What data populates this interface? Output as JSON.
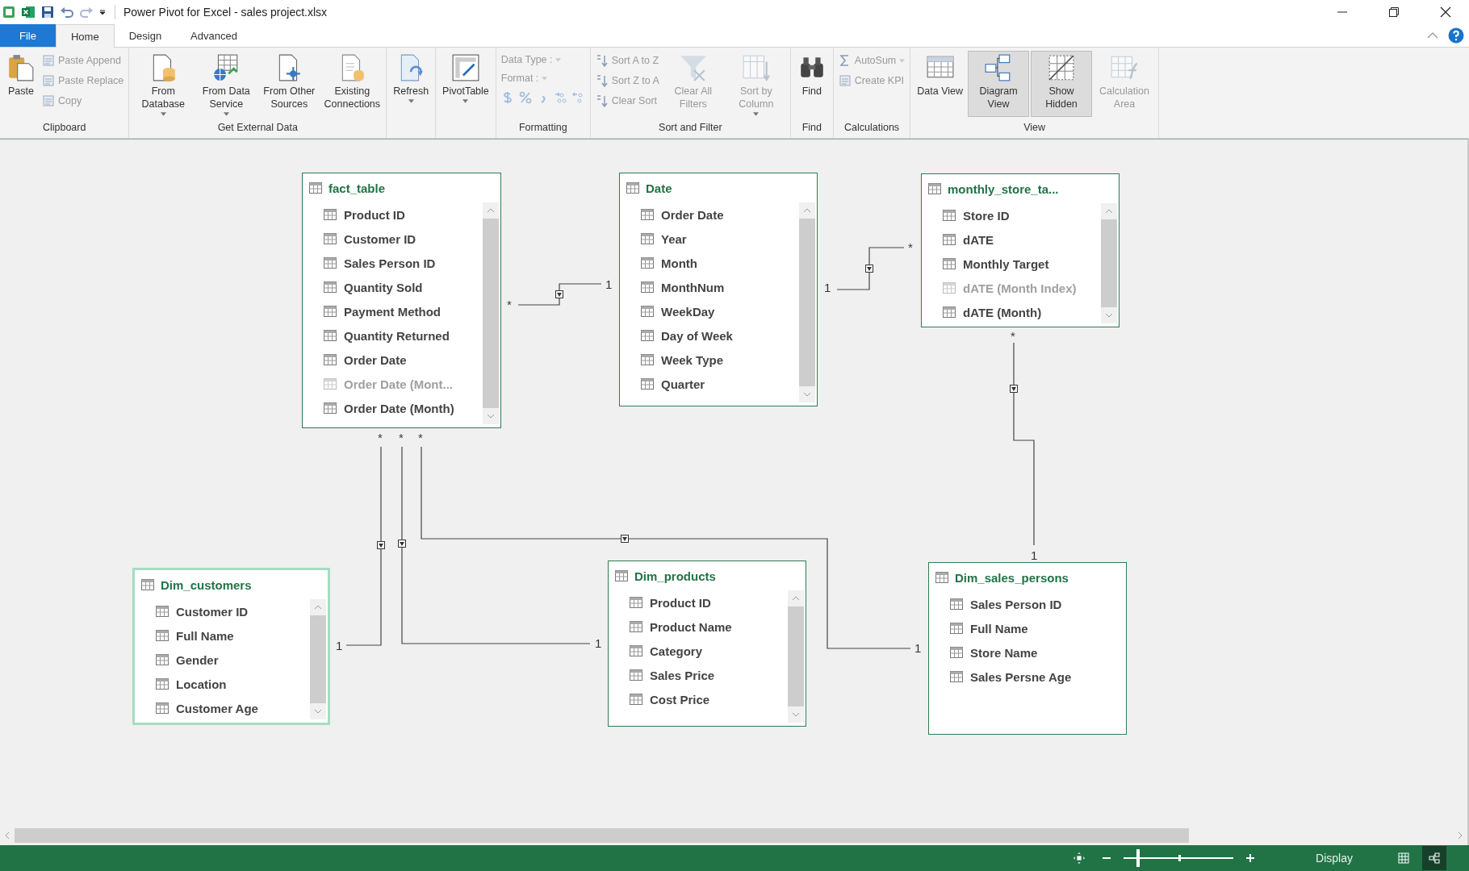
{
  "window": {
    "title": "Power Pivot for Excel - sales project.xlsx"
  },
  "tabs": [
    {
      "label": "File",
      "kind": "file",
      "selected": false
    },
    {
      "label": "Home",
      "kind": "tab",
      "selected": true
    },
    {
      "label": "Design",
      "kind": "tab",
      "selected": false
    },
    {
      "label": "Advanced",
      "kind": "tab",
      "selected": false
    }
  ],
  "ribbon": [
    {
      "label": "Clipboard",
      "buttons": [
        {
          "label": "Paste",
          "kind": "large",
          "disabled": false,
          "dropdown": false
        },
        {
          "label": "Paste Append",
          "kind": "small",
          "disabled": true,
          "dropdown": false
        },
        {
          "label": "Paste Replace",
          "kind": "small",
          "disabled": true,
          "dropdown": false
        },
        {
          "label": "Copy",
          "kind": "small",
          "disabled": true,
          "dropdown": false
        }
      ]
    },
    {
      "label": "Get External Data",
      "buttons": [
        {
          "label": "From Database",
          "kind": "large",
          "disabled": false,
          "dropdown": true
        },
        {
          "label": "From Data Service",
          "kind": "large",
          "disabled": false,
          "dropdown": true
        },
        {
          "label": "From Other Sources",
          "kind": "large",
          "disabled": false,
          "dropdown": false
        },
        {
          "label": "Existing Connections",
          "kind": "large",
          "disabled": false,
          "dropdown": false
        }
      ]
    },
    {
      "buttons": [
        {
          "label": "Refresh",
          "kind": "large",
          "disabled": false,
          "dropdown": true
        }
      ]
    },
    {
      "buttons": [
        {
          "label": "PivotTable",
          "kind": "large",
          "disabled": false,
          "dropdown": true
        }
      ]
    },
    {
      "label": "Formatting",
      "buttons": [
        {
          "label": "Data Type :",
          "kind": "small",
          "disabled": true,
          "dropdown": true
        },
        {
          "label": "Format :",
          "kind": "small",
          "disabled": true,
          "dropdown": true
        },
        {
          "kind": "format-icons",
          "disabled": true
        }
      ]
    },
    {
      "label": "Sort and Filter",
      "buttons": [
        {
          "label": "Sort A to Z",
          "kind": "small",
          "disabled": true,
          "dropdown": false
        },
        {
          "label": "Sort Z to A",
          "kind": "small",
          "disabled": true,
          "dropdown": false
        },
        {
          "label": "Clear Sort",
          "kind": "small",
          "disabled": true,
          "dropdown": false
        },
        {
          "label": "Clear All Filters",
          "kind": "large",
          "disabled": true,
          "dropdown": false
        },
        {
          "label": "Sort by Column",
          "kind": "large",
          "disabled": true,
          "dropdown": true
        }
      ]
    },
    {
      "label": "Find",
      "buttons": [
        {
          "label": "Find",
          "kind": "large",
          "disabled": false,
          "dropdown": false
        }
      ]
    },
    {
      "label": "Calculations",
      "buttons": [
        {
          "label": "AutoSum",
          "kind": "small",
          "disabled": true,
          "dropdown": true
        },
        {
          "label": "Create KPI",
          "kind": "small",
          "disabled": true,
          "dropdown": false
        }
      ]
    },
    {
      "label": "View",
      "buttons": [
        {
          "label": "Data View",
          "kind": "large",
          "disabled": false,
          "dropdown": false,
          "selected": false
        },
        {
          "label": "Diagram View",
          "kind": "large",
          "disabled": false,
          "dropdown": false,
          "selected": true
        },
        {
          "label": "Show Hidden",
          "kind": "large",
          "disabled": false,
          "dropdown": false,
          "selected": true
        },
        {
          "label": "Calculation Area",
          "kind": "large",
          "disabled": true,
          "dropdown": false,
          "selected": false
        }
      ]
    }
  ],
  "tables": [
    {
      "name": "fact_table",
      "selected": false,
      "scrollable": true,
      "fields": [
        {
          "name": "Product ID",
          "hidden": false
        },
        {
          "name": "Customer ID",
          "hidden": false
        },
        {
          "name": "Sales Person ID",
          "hidden": false
        },
        {
          "name": "Quantity Sold",
          "hidden": false
        },
        {
          "name": "Payment Method",
          "hidden": false
        },
        {
          "name": "Quantity Returned",
          "hidden": false
        },
        {
          "name": "Order Date",
          "hidden": false
        },
        {
          "name": "Order Date (Mont...",
          "hidden": true
        },
        {
          "name": "Order Date (Month)",
          "hidden": false
        }
      ]
    },
    {
      "name": "Date",
      "selected": false,
      "scrollable": true,
      "fields": [
        {
          "name": "Order Date",
          "hidden": false
        },
        {
          "name": "Year",
          "hidden": false
        },
        {
          "name": "Month",
          "hidden": false
        },
        {
          "name": "MonthNum",
          "hidden": false
        },
        {
          "name": "WeekDay",
          "hidden": false
        },
        {
          "name": "Day of Week",
          "hidden": false
        },
        {
          "name": "Week Type",
          "hidden": false
        },
        {
          "name": "Quarter",
          "hidden": false
        }
      ]
    },
    {
      "name": "monthly_store_ta...",
      "selected": false,
      "scrollable": true,
      "fields": [
        {
          "name": "Store ID",
          "hidden": false
        },
        {
          "name": "dATE",
          "hidden": false
        },
        {
          "name": "Monthly Target",
          "hidden": false
        },
        {
          "name": "dATE (Month Index)",
          "hidden": true
        },
        {
          "name": "dATE (Month)",
          "hidden": false
        }
      ]
    },
    {
      "name": "Dim_customers",
      "selected": true,
      "scrollable": true,
      "fields": [
        {
          "name": "Customer ID",
          "hidden": false
        },
        {
          "name": "Full Name",
          "hidden": false
        },
        {
          "name": "Gender",
          "hidden": false
        },
        {
          "name": "Location",
          "hidden": false
        },
        {
          "name": "Customer Age",
          "hidden": false
        }
      ]
    },
    {
      "name": "Dim_products",
      "selected": false,
      "scrollable": true,
      "fields": [
        {
          "name": "Product ID",
          "hidden": false
        },
        {
          "name": "Product Name",
          "hidden": false
        },
        {
          "name": "Category",
          "hidden": false
        },
        {
          "name": "Sales Price",
          "hidden": false
        },
        {
          "name": "Cost Price",
          "hidden": false
        }
      ]
    },
    {
      "name": "Dim_sales_persons",
      "selected": false,
      "scrollable": false,
      "fields": [
        {
          "name": "Sales Person ID",
          "hidden": false
        },
        {
          "name": "Full Name",
          "hidden": false
        },
        {
          "name": "Store Name",
          "hidden": false
        },
        {
          "name": "Sales Persne Age",
          "hidden": false
        }
      ]
    }
  ],
  "relationships": [
    {
      "many_label": "*",
      "one_label": "1"
    },
    {
      "many_label": "*",
      "one_label": "1"
    },
    {
      "many_label": "*",
      "one_label": "1"
    },
    {
      "many_label": "*",
      "one_label": "1"
    },
    {
      "many_label": "*",
      "one_label": "1"
    },
    {
      "many_label": "*",
      "one_label": "1"
    }
  ],
  "status_bar": {
    "zoom": {
      "level": 0.12
    },
    "display_label": "Display",
    "views": [
      {
        "kind": "grid",
        "selected": false
      },
      {
        "kind": "diagram",
        "selected": true
      }
    ]
  }
}
